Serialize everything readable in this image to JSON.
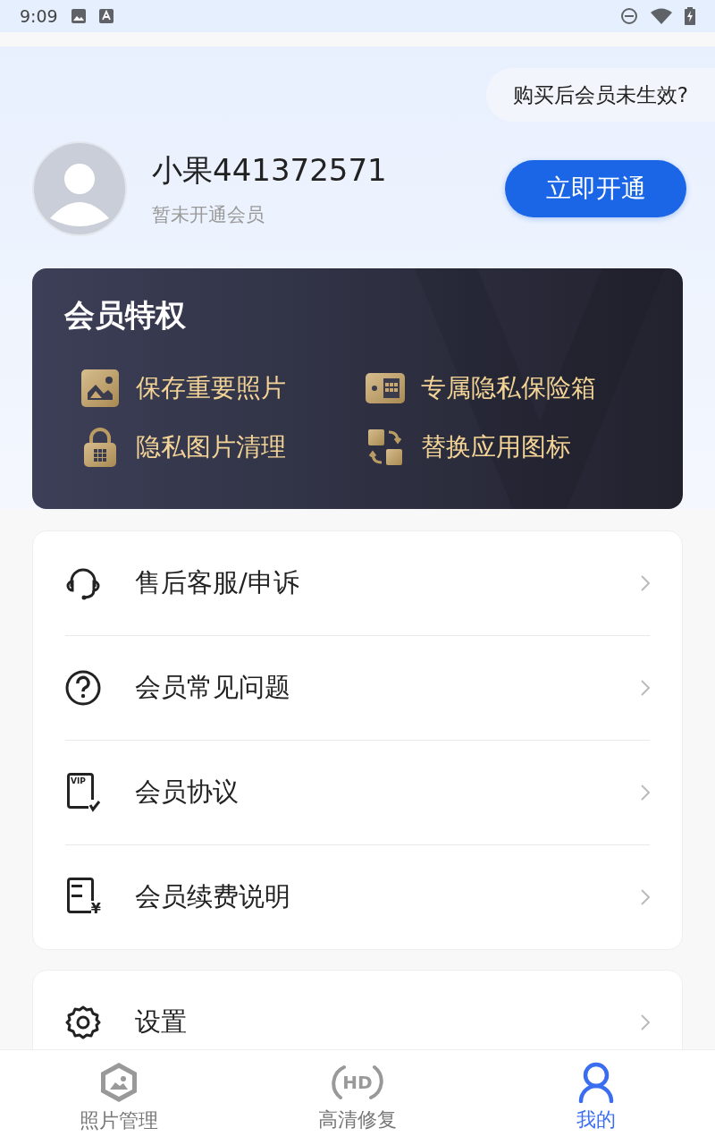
{
  "status_bar": {
    "time": "9:09"
  },
  "help_pill": "购买后会员未生效?",
  "profile": {
    "name": "小果441372571",
    "status": "暂未开通会员",
    "button": "立即开通"
  },
  "privileges": {
    "title": "会员特权",
    "items": [
      {
        "kind": "photo",
        "label": "保存重要照片"
      },
      {
        "kind": "safe",
        "label": "专属隐私保险箱"
      },
      {
        "kind": "lock",
        "label": "隐私图片清理"
      },
      {
        "kind": "swap",
        "label": "替换应用图标"
      }
    ]
  },
  "menu": [
    {
      "kind": "headset",
      "label": "售后客服/申诉"
    },
    {
      "kind": "question",
      "label": "会员常见问题"
    },
    {
      "kind": "vip",
      "label": "会员协议",
      "icon_text": "VIP"
    },
    {
      "kind": "bill",
      "label": "会员续费说明",
      "icon_text": "¥"
    }
  ],
  "settings": {
    "label": "设置"
  },
  "nav": [
    {
      "kind": "photo",
      "label": "照片管理",
      "selected": false
    },
    {
      "kind": "hd",
      "label": "高清修复",
      "icon_text": "HD",
      "selected": false
    },
    {
      "kind": "user",
      "label": "我的",
      "selected": true
    }
  ]
}
